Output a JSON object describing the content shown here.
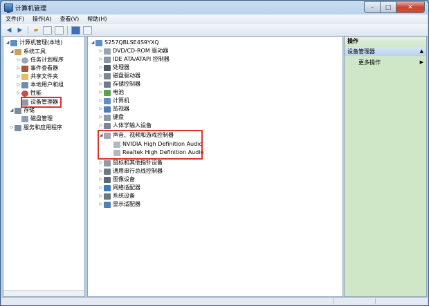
{
  "window": {
    "title": "计算机管理"
  },
  "menubar": [
    "文件(F)",
    "操作(A)",
    "查看(V)",
    "帮助(H)"
  ],
  "tree": {
    "root": "计算机管理(本地)",
    "system_tools": "系统工具",
    "task_scheduler": "任务计划程序",
    "event_viewer": "事件查看器",
    "shared_folders": "共享文件夹",
    "local_users": "本地用户和组",
    "performance": "性能",
    "device_manager": "设备管理器",
    "storage": "存储",
    "disk_management": "磁盘管理",
    "services_apps": "服务和应用程序"
  },
  "devices": {
    "computer_name": "S257QBLSE4S9YXQ",
    "dvd": "DVD/CD-ROM 驱动器",
    "ide": "IDE ATA/ATAPI 控制器",
    "processor": "处理器",
    "disk_drives": "磁盘驱动器",
    "storage_ctrl": "存储控制器",
    "battery": "电池",
    "computer": "计算机",
    "monitor": "监视器",
    "keyboard": "键盘",
    "hid": "人体学输入设备",
    "sound": "声音、视频和游戏控制器",
    "nvidia_audio": "NVIDIA High Definition Audio",
    "realtek_audio": "Realtek High Definition Audio",
    "mouse": "鼠标和其他指针设备",
    "usb": "通用串行总线控制器",
    "imaging": "图像设备",
    "network": "网络适配器",
    "system": "系统设备",
    "display": "显示适配器"
  },
  "actions": {
    "header": "操作",
    "selected": "设备管理器",
    "more": "更多操作"
  },
  "colors": {
    "highlight_box": "#e0302b",
    "actions_bg": "#cfe7c6"
  }
}
